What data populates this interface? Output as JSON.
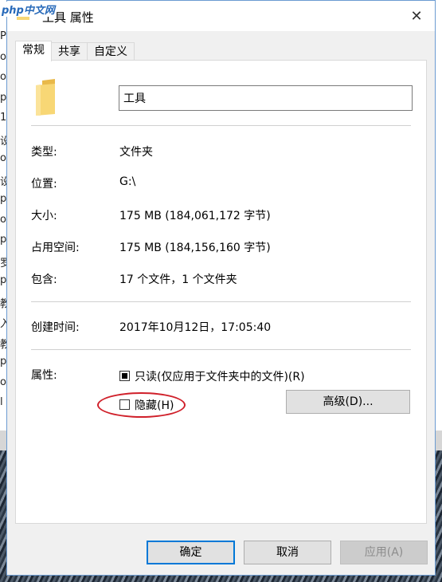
{
  "logo": {
    "text_latin": "php",
    "text_cn": "中文网"
  },
  "window": {
    "title": "工具 属性",
    "close_glyph": "✕"
  },
  "tabs": [
    {
      "label": "常规",
      "active": true
    },
    {
      "label": "共享",
      "active": false
    },
    {
      "label": "自定义",
      "active": false
    }
  ],
  "name_field": {
    "value": "工具"
  },
  "properties": [
    {
      "label": "类型:",
      "value": "文件夹"
    },
    {
      "label": "位置:",
      "value": "G:\\"
    },
    {
      "label": "大小:",
      "value": "175 MB (184,061,172 字节)"
    },
    {
      "label": "占用空间:",
      "value": "175 MB (184,156,160 字节)"
    },
    {
      "label": "包含:",
      "value": "17 个文件，1 个文件夹"
    }
  ],
  "created": {
    "label": "创建时间:",
    "value": "2017年10月12日，17:05:40"
  },
  "attributes": {
    "label": "属性:",
    "readonly": {
      "label": "只读(仅应用于文件夹中的文件)(R)",
      "checked": "indeterminate"
    },
    "hidden": {
      "label": "隐藏(H)",
      "checked": false
    },
    "advanced_button": "高级(D)..."
  },
  "buttons": {
    "ok": "确定",
    "cancel": "取消",
    "apply": "应用(A)"
  },
  "background_left_chars": [
    "P",
    "o.",
    "o.",
    "p",
    "1.",
    "设",
    "o.",
    "设",
    "p",
    "o.",
    "p",
    "罗",
    "p",
    "教",
    "入",
    "教",
    "p",
    "o",
    "l"
  ],
  "colors": {
    "accent": "#0078d7",
    "annotation": "#d0202a",
    "folder": "#f8d775"
  }
}
